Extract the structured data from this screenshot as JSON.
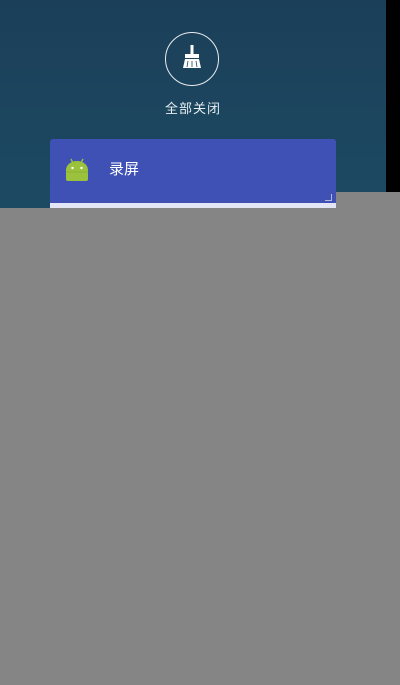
{
  "recents": {
    "clear_all_label": "全部关闭",
    "clear_all_icon": "broom-icon"
  },
  "task": {
    "title": "录屏",
    "icon": "android-icon",
    "header_color": "#3f51b5"
  },
  "colors": {
    "background": "#1d4a63",
    "overlay": "#858585"
  }
}
